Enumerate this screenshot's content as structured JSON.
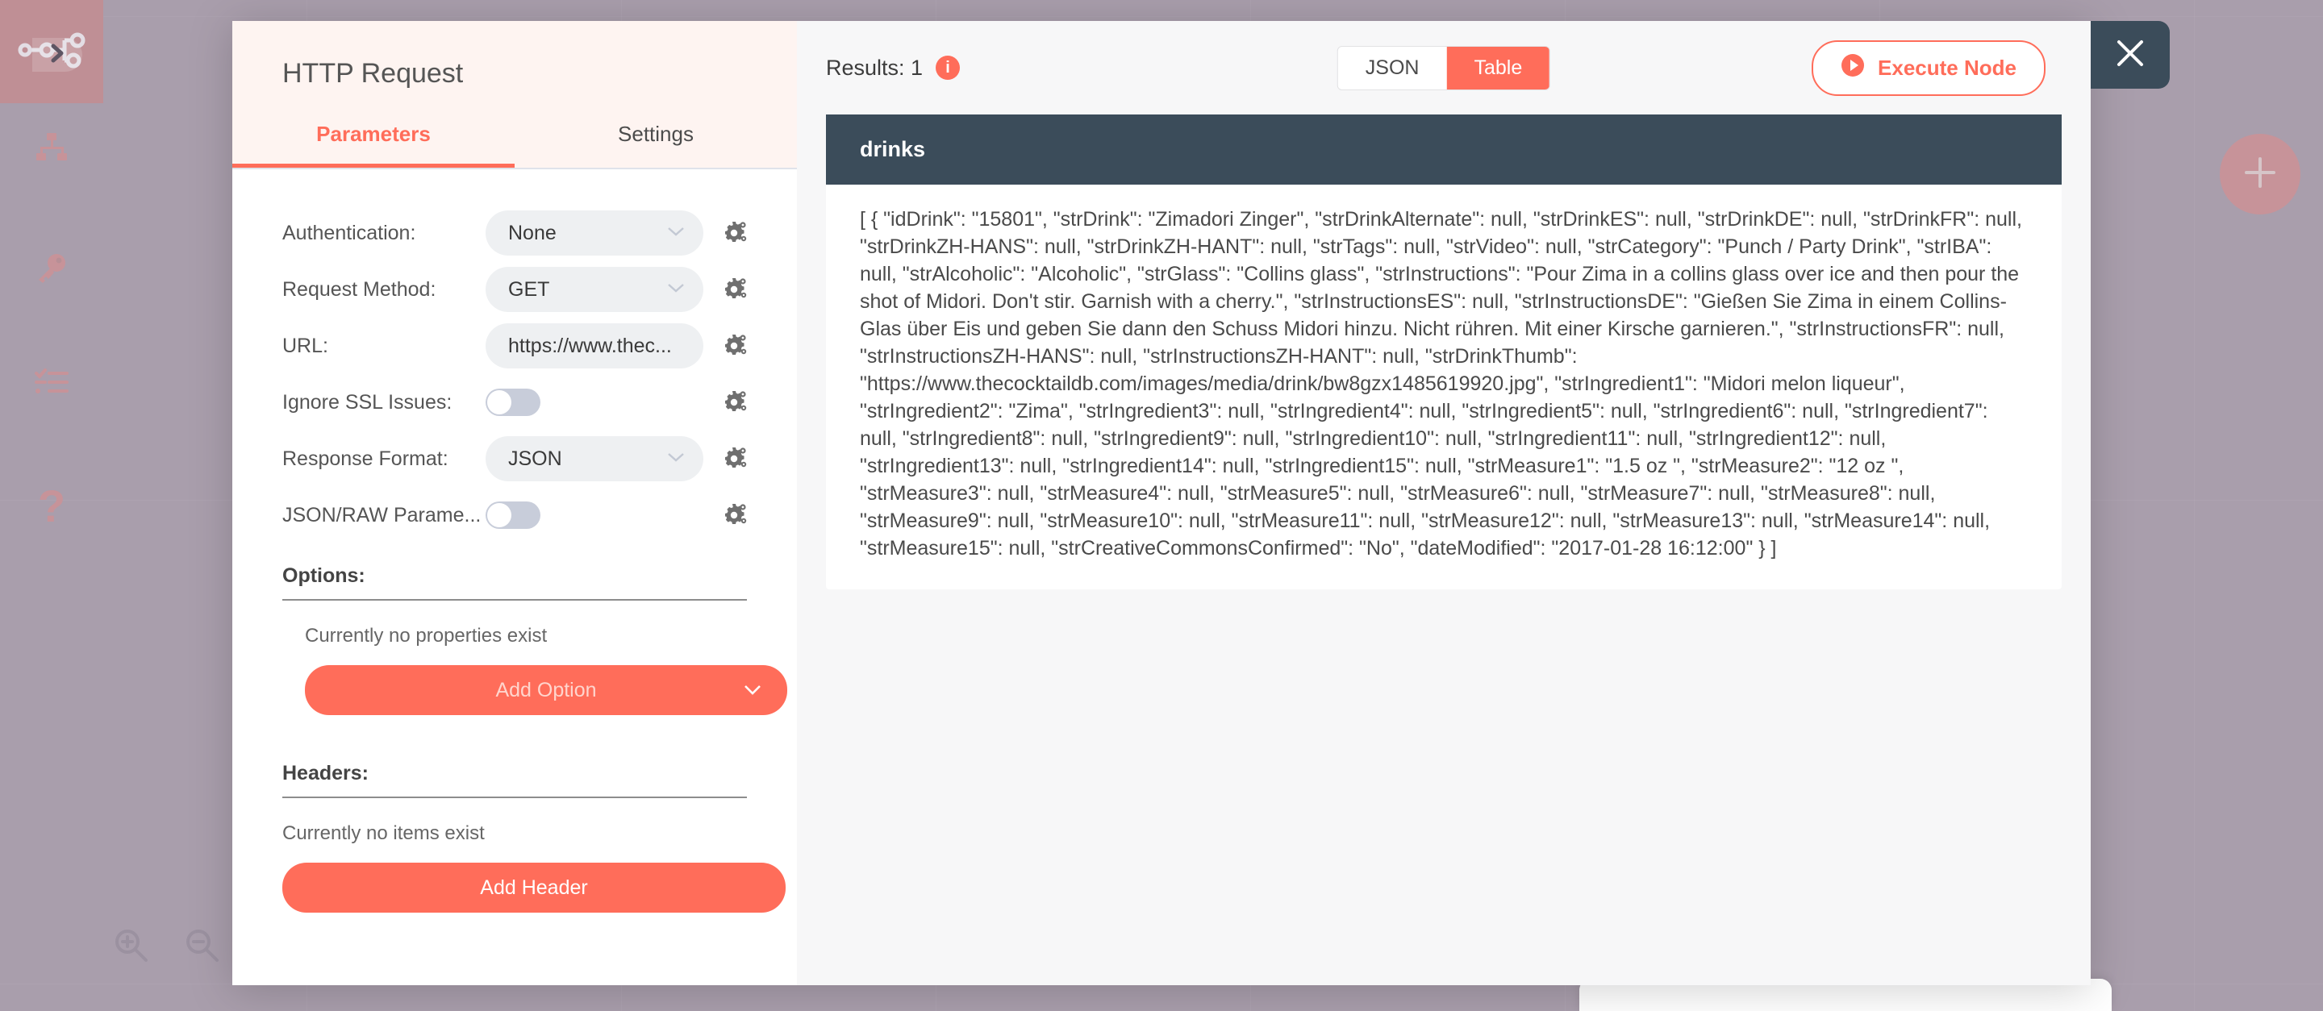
{
  "sidebar": {
    "items": [
      {
        "name": "logo",
        "icon": "n8n-logo-icon"
      },
      {
        "name": "expand",
        "icon": "chevron-right-icon"
      },
      {
        "name": "workflows",
        "icon": "sitemap-icon"
      },
      {
        "name": "credentials",
        "icon": "key-icon"
      },
      {
        "name": "executions",
        "icon": "checklist-icon"
      },
      {
        "name": "help",
        "icon": "question-mark-icon"
      }
    ]
  },
  "canvas": {
    "zoom_in_icon": "zoom-in-icon",
    "zoom_out_icon": "zoom-out-icon",
    "add_node_icon": "plus-icon"
  },
  "node_detail": {
    "title": "HTTP Request",
    "tabs": [
      {
        "label": "Parameters",
        "active": true
      },
      {
        "label": "Settings",
        "active": false
      }
    ],
    "close_icon": "close-icon",
    "gear_icon": "gear-settings-icon",
    "fields": [
      {
        "label": "Authentication:",
        "type": "select",
        "value": "None"
      },
      {
        "label": "Request Method:",
        "type": "select",
        "value": "GET"
      },
      {
        "label": "URL:",
        "type": "select",
        "value": "https://www.thec..."
      },
      {
        "label": "Ignore SSL Issues:",
        "type": "toggle",
        "value": "off"
      },
      {
        "label": "Response Format:",
        "type": "select",
        "value": "JSON"
      },
      {
        "label": "JSON/RAW Parame...",
        "type": "toggle",
        "value": "off"
      }
    ],
    "options_section": {
      "title": "Options:",
      "empty_text": "Currently no properties exist",
      "button_label": "Add Option",
      "button_caret": "⌄"
    },
    "headers_section": {
      "title": "Headers:",
      "empty_text": "Currently no items exist",
      "button_label": "Add Header"
    }
  },
  "output": {
    "results_label": "Results: 1",
    "info_badge": "i",
    "view_tabs": [
      {
        "label": "JSON",
        "active": false
      },
      {
        "label": "Table",
        "active": true
      }
    ],
    "execute_button": {
      "label": "Execute Node",
      "icon": "play-circle-icon"
    },
    "table": {
      "column_header": "drinks",
      "cell_text": "[ { \"idDrink\": \"15801\", \"strDrink\": \"Zimadori Zinger\", \"strDrinkAlternate\": null, \"strDrinkES\": null, \"strDrinkDE\": null, \"strDrinkFR\": null, \"strDrinkZH-HANS\": null, \"strDrinkZH-HANT\": null, \"strTags\": null, \"strVideo\": null, \"strCategory\": \"Punch / Party Drink\", \"strIBA\": null, \"strAlcoholic\": \"Alcoholic\", \"strGlass\": \"Collins glass\", \"strInstructions\": \"Pour Zima in a collins glass over ice and then pour the shot of Midori. Don't stir. Garnish with a cherry.\", \"strInstructionsES\": null, \"strInstructionsDE\": \"Gießen Sie Zima in einem Collins-Glas über Eis und geben Sie dann den Schuss Midori hinzu. Nicht rühren. Mit einer Kirsche garnieren.\", \"strInstructionsFR\": null, \"strInstructionsZH-HANS\": null, \"strInstructionsZH-HANT\": null, \"strDrinkThumb\": \"https://www.thecocktaildb.com/images/media/drink/bw8gzx1485619920.jpg\", \"strIngredient1\": \"Midori melon liqueur\", \"strIngredient2\": \"Zima\", \"strIngredient3\": null, \"strIngredient4\": null, \"strIngredient5\": null, \"strIngredient6\": null, \"strIngredient7\": null, \"strIngredient8\": null, \"strIngredient9\": null, \"strIngredient10\": null, \"strIngredient11\": null, \"strIngredient12\": null, \"strIngredient13\": null, \"strIngredient14\": null, \"strIngredient15\": null, \"strMeasure1\": \"1.5 oz \", \"strMeasure2\": \"12 oz \", \"strMeasure3\": null, \"strMeasure4\": null, \"strMeasure5\": null, \"strMeasure6\": null, \"strMeasure7\": null, \"strMeasure8\": null, \"strMeasure9\": null, \"strMeasure10\": null, \"strMeasure11\": null, \"strMeasure12\": null, \"strMeasure13\": null, \"strMeasure14\": null, \"strMeasure15\": null, \"strCreativeCommonsConfirmed\": \"No\", \"dateModified\": \"2017-01-28 16:12:00\" } ]"
    }
  },
  "colors": {
    "accent": "#ff6d5a",
    "accent_soft": "#fef4f1",
    "dark_slate": "#3b4c5a",
    "canvas": "#a99eac"
  }
}
